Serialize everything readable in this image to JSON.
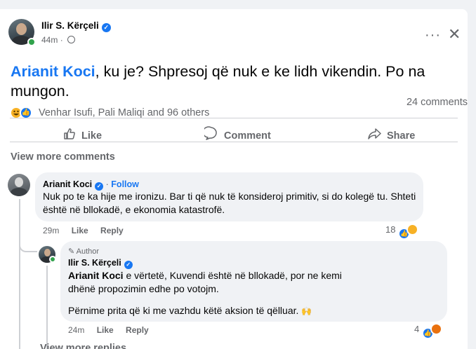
{
  "post": {
    "author": "Ilir S. Kërçeli",
    "time": "44m",
    "separator": "·",
    "mention": "Arianit Koci",
    "text": ", ku je? Shpresoj që nuk e ke lidh vikendin. Po na mungon.",
    "reaction_names": "Venhar Isufi, Pali Maliqi and 96 others",
    "comments_count": "24 comments"
  },
  "actions": {
    "like": "Like",
    "comment": "Comment",
    "share": "Share"
  },
  "view_more_comments": "View more comments",
  "comment1": {
    "author": "Arianit Koci",
    "follow": "Follow",
    "separator": "·",
    "text": "Nuk po te ka hije me ironizu. Bar ti që nuk të konsideroj primitiv, si do kolegë tu. Shteti është në bllokadë, e ekonomia katastrofë.",
    "time": "29m",
    "like": "Like",
    "reply": "Reply",
    "reaction_count": "18"
  },
  "reply1": {
    "author_tag": "Author",
    "author": "Ilir S. Kërçeli",
    "mention": "Arianit Koci",
    "text": " e vërtetë, Kuvendi është në bllokadë, por ne kemi dhënë propozimin edhe po votojm.",
    "text2": "Përnime prita që ki me vazhdu këtë aksion të qëlluar.",
    "emoji": "🙌",
    "time": "24m",
    "like": "Like",
    "reply": "Reply",
    "reaction_count": "4"
  },
  "view_more_replies": "View more replies",
  "colors": {
    "link_blue": "#1877f2",
    "muted": "#65676b",
    "bubble": "#f0f2f5",
    "online": "#31a24c"
  }
}
